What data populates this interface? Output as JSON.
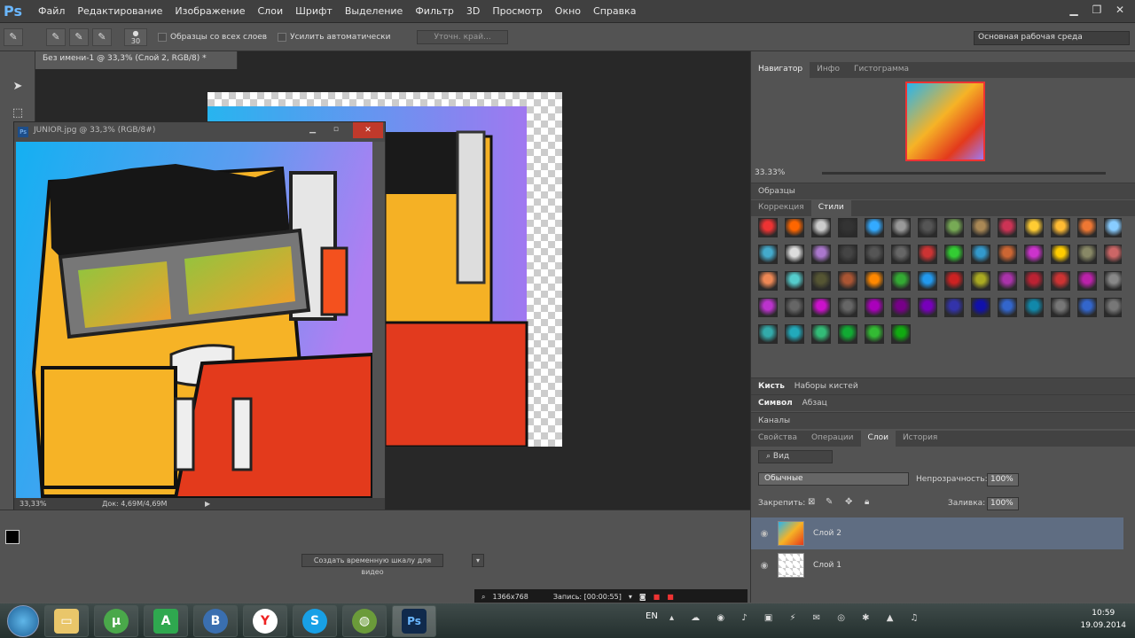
{
  "menubar": {
    "logo": "Ps",
    "items": [
      "Файл",
      "Редактирование",
      "Изображение",
      "Слои",
      "Шрифт",
      "Выделение",
      "Фильтр",
      "3D",
      "Просмотр",
      "Окно",
      "Справка"
    ]
  },
  "options": {
    "brush_size": "30",
    "sample_all_label": "Образцы со всех слоев",
    "auto_enhance_label": "Усилить автоматически",
    "refine_label": "Уточн. край...",
    "workspace": "Основная рабочая среда"
  },
  "document": {
    "tab": "Без имени-1 @ 33,3% (Слой 2, RGB/8) *",
    "float_title": "JUNIOR.jpg @ 33,3% (RGB/8#)",
    "zoom": "33,33%",
    "doc_size": "Док: 4,69M/4,69M"
  },
  "timeline": {
    "create_button": "Создать временную шкалу для видео"
  },
  "recorder": {
    "resolution": "1366x768",
    "record_label": "Запись: [00:00:55]"
  },
  "panels": {
    "navigator_tabs": [
      "Навигатор",
      "Инфо",
      "Гистограмма"
    ],
    "navigator_zoom": "33.33%",
    "swatches": "Образцы",
    "styles_tabs": [
      "Коррекция",
      "Стили"
    ],
    "brush_tabs": [
      "Кисть",
      "Наборы кистей"
    ],
    "symbol_tabs": [
      "Символ",
      "Абзац"
    ],
    "channels": "Каналы",
    "layers_tabs": [
      "Свойства",
      "Операции",
      "Слои",
      "История"
    ],
    "layer_filter": "Вид",
    "blend_mode": "Обычные",
    "opacity_label": "Непрозрачность:",
    "opacity": "100%",
    "lock_label": "Закрепить:",
    "fill_label": "Заливка:",
    "fill": "100%",
    "layers": [
      "Слой 2",
      "Слой 1"
    ]
  },
  "taskbar": {
    "lang": "EN",
    "time": "10:59",
    "date": "19.09.2014"
  },
  "colors": {
    "accent": "#4a90d9",
    "ps_blue": "#6ab7ff",
    "char_orange": "#ffb627",
    "char_red": "#e8341c"
  }
}
